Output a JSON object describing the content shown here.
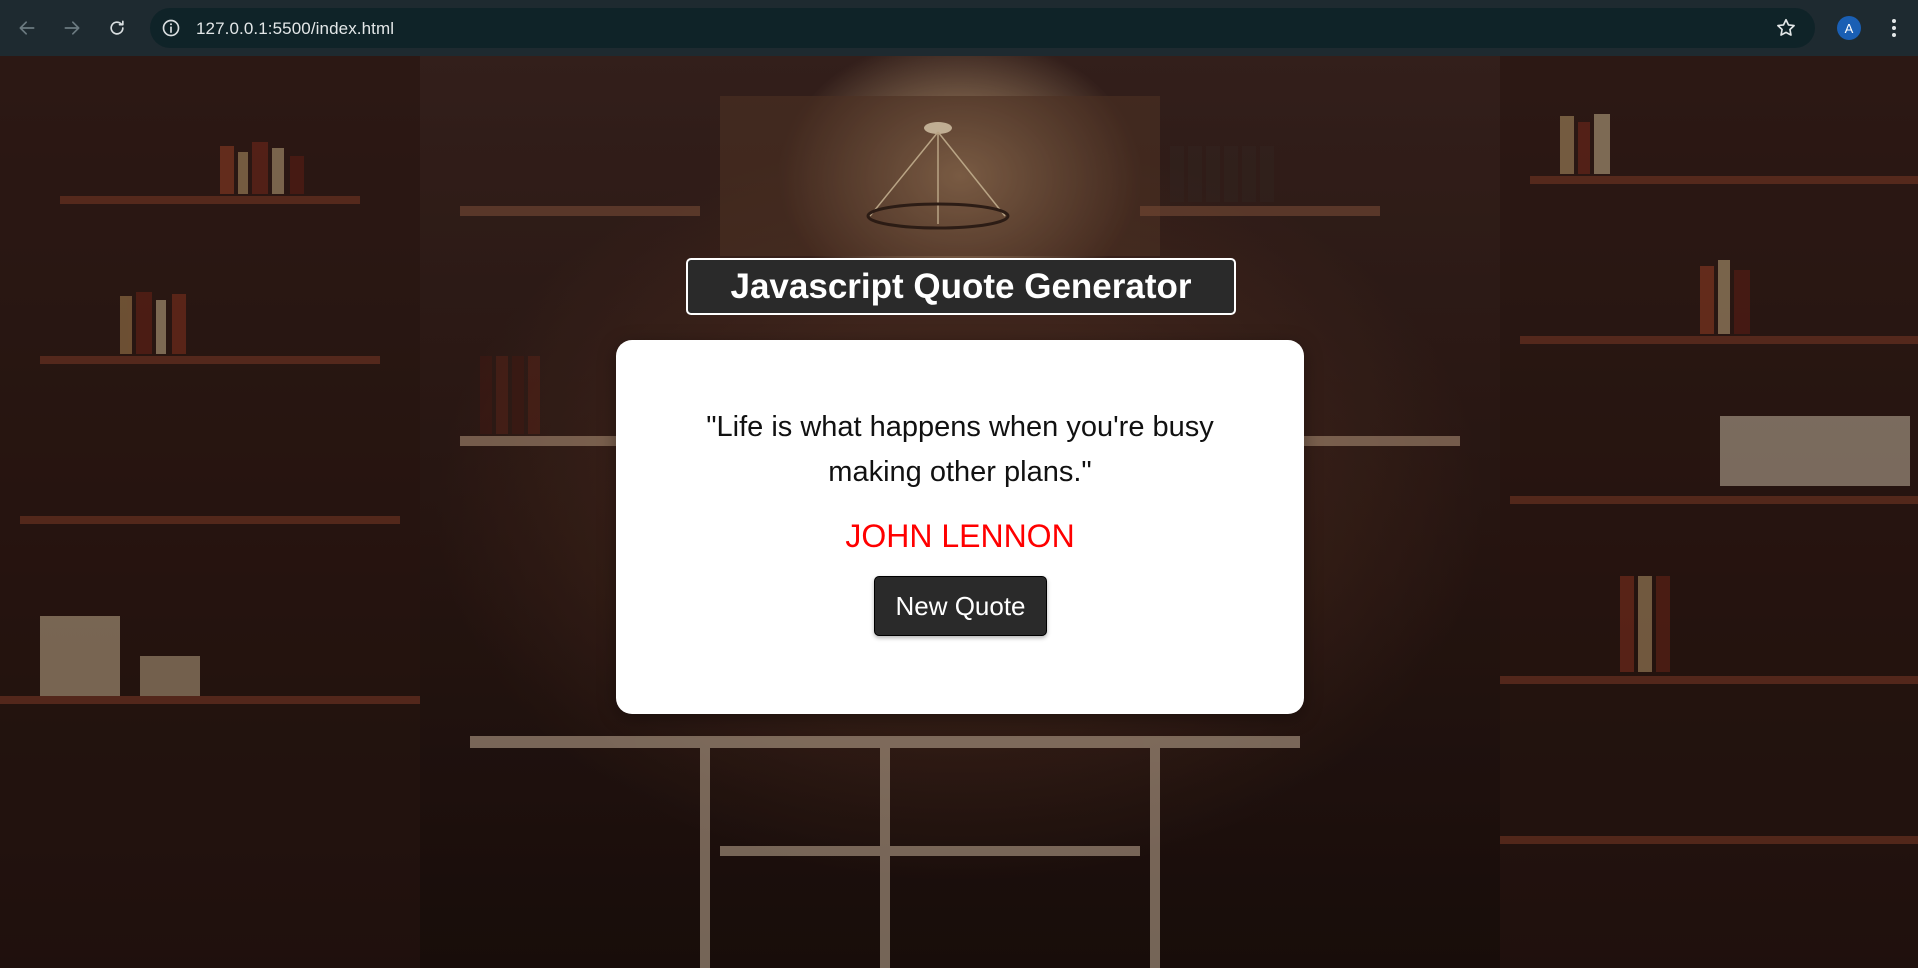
{
  "browser": {
    "url": "127.0.0.1:5500/index.html",
    "profile_initial": "A",
    "icons": [
      "back-arrow-icon",
      "forward-arrow-icon",
      "reload-icon",
      "site-info-icon",
      "bookmark-star-icon",
      "menu-kebab-icon"
    ]
  },
  "app": {
    "title": "Javascript Quote Generator",
    "quote": "\"Life is what happens when you're busy making other plans.\"",
    "author": "JOHN LENNON",
    "new_quote_label": "New Quote"
  },
  "colors": {
    "chrome_bg": "#1e2a30",
    "omnibox_bg": "#0f2328",
    "title_bg": "#2a2a2a",
    "card_bg": "#ffffff",
    "author_color": "#ff0000",
    "button_bg": "#2a2a2a",
    "avatar_bg": "#1a5fb4"
  }
}
